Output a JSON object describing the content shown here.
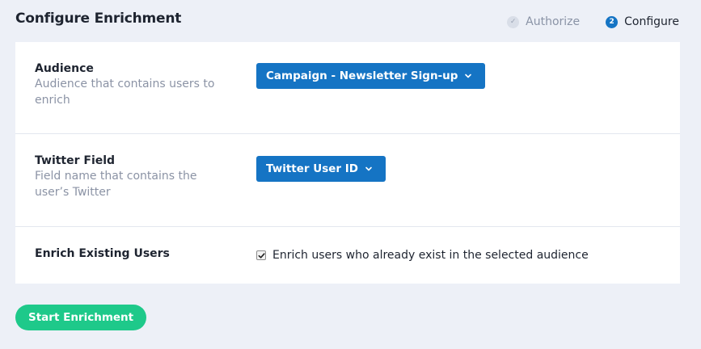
{
  "header": {
    "title": "Configure Enrichment"
  },
  "steps": [
    {
      "badge": "✓",
      "label": "Authorize",
      "state": "done"
    },
    {
      "badge": "2",
      "label": "Configure",
      "state": "active"
    }
  ],
  "form": {
    "audience": {
      "label": "Audience",
      "help": "Audience that contains users to enrich",
      "selected": "Campaign - Newsletter Sign-up"
    },
    "twitter_field": {
      "label": "Twitter Field",
      "help": "Field name that contains the user’s Twitter",
      "selected": "Twitter User ID"
    },
    "enrich_existing": {
      "label": "Enrich Existing Users",
      "checkbox_label": "Enrich users who already exist in the selected audience",
      "checked": true
    }
  },
  "actions": {
    "start_label": "Start Enrichment"
  },
  "colors": {
    "accent": "#1574c4",
    "primary_button": "#1ec98a",
    "background": "#edf0f7"
  },
  "icons": {
    "dropdown": "chevron-down-icon",
    "step_done": "check-icon",
    "checkbox": "checkmark-icon"
  }
}
